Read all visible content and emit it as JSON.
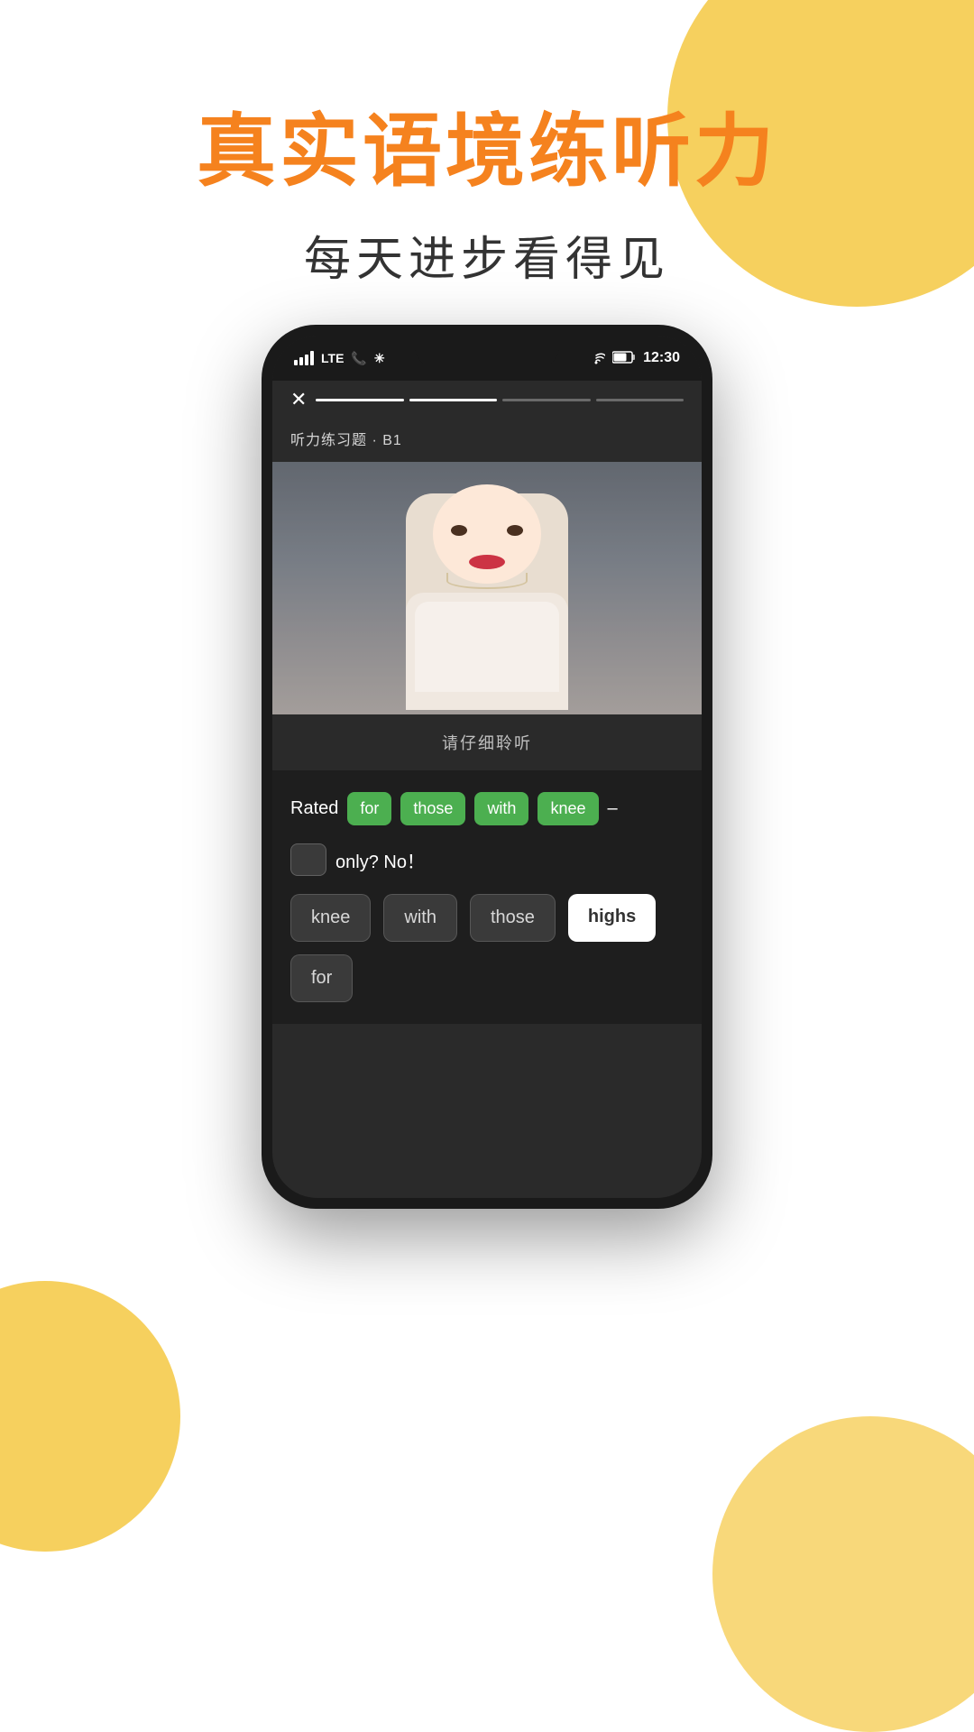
{
  "page": {
    "background_color": "#ffffff"
  },
  "header": {
    "main_title": "真实语境练听力",
    "sub_title": "每天进步看得见",
    "title_color": "#F5821E",
    "subtitle_color": "#333333"
  },
  "phone": {
    "status_bar": {
      "signal": "LTE",
      "time": "12:30",
      "battery": "□",
      "wifi": "wifi"
    },
    "exercise_label": "听力练习题 · B1",
    "listen_text": "请仔细聆听",
    "sentence": {
      "prefix": "Rated",
      "words": [
        "for",
        "those",
        "with",
        "knee"
      ],
      "dash": "–",
      "only_no": "only?  No！"
    },
    "options": [
      "knee",
      "with",
      "those",
      "highs",
      "for"
    ],
    "options_highlighted": [
      "highs"
    ],
    "progress_segments": [
      {
        "active": true
      },
      {
        "active": true
      },
      {
        "active": false
      },
      {
        "active": false
      }
    ]
  },
  "decorative": {
    "circle_color": "#F5C842"
  }
}
